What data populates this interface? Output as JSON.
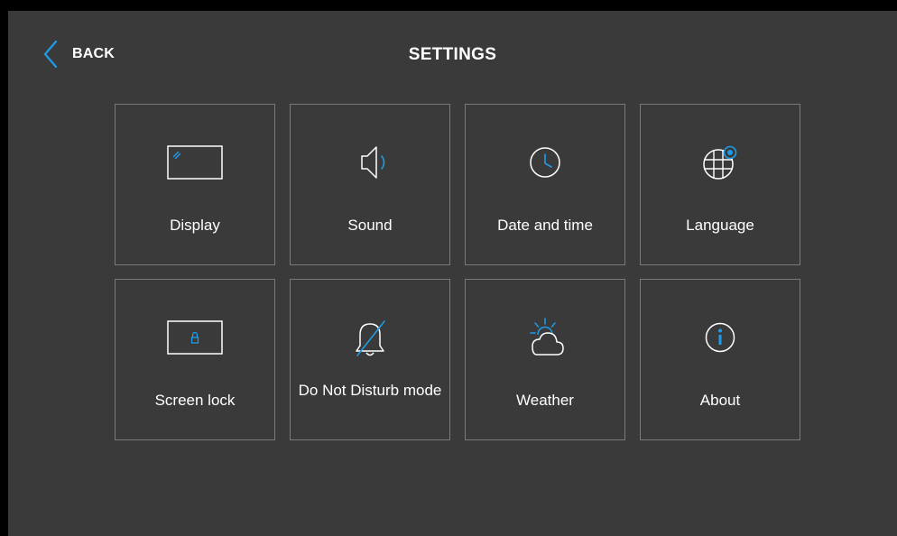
{
  "header": {
    "back_label": "BACK",
    "title": "SETTINGS"
  },
  "colors": {
    "accent": "#1e9be9",
    "background": "#3a3a3a",
    "tile_border": "#7a7a7a",
    "text": "#ffffff"
  },
  "tiles": [
    {
      "label": "Display",
      "icon": "display-icon"
    },
    {
      "label": "Sound",
      "icon": "speaker-icon"
    },
    {
      "label": "Date and time",
      "icon": "clock-icon"
    },
    {
      "label": "Language",
      "icon": "globe-icon"
    },
    {
      "label": "Screen lock",
      "icon": "screen-lock-icon"
    },
    {
      "label": "Do Not Disturb mode",
      "icon": "bell-off-icon"
    },
    {
      "label": "Weather",
      "icon": "weather-icon"
    },
    {
      "label": "About",
      "icon": "info-icon"
    }
  ]
}
